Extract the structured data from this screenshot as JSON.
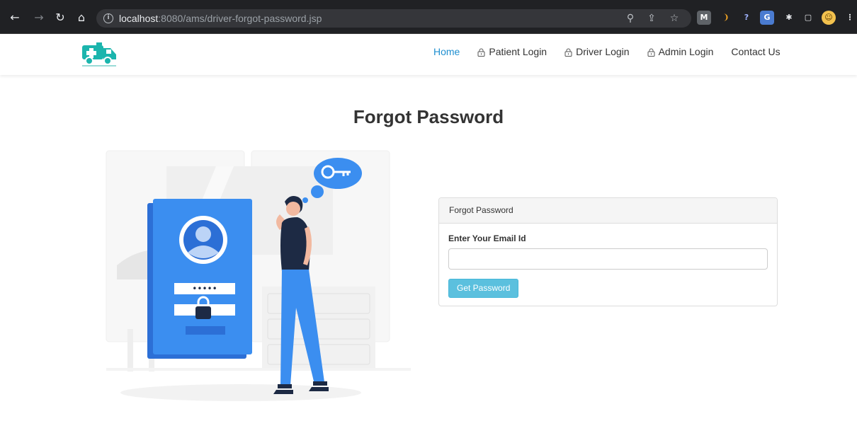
{
  "browser": {
    "url_host": "localhost",
    "url_rest": ":8080/ams/driver-forgot-password.jsp",
    "extensions": [
      {
        "name": "m-extension",
        "glyph": "M",
        "color": "#5f6368"
      },
      {
        "name": "orange-extension",
        "glyph": "❩",
        "color": "#202124"
      },
      {
        "name": "badge-extension",
        "glyph": "0",
        "color": "#202124"
      },
      {
        "name": "translate-extension",
        "glyph": "G",
        "color": "#4a7bd0"
      },
      {
        "name": "puzzle-extension",
        "glyph": "✱",
        "color": "#202124"
      },
      {
        "name": "sidepanel-extension",
        "glyph": "▢",
        "color": "#202124"
      }
    ]
  },
  "nav": {
    "home": "Home",
    "patient_login": "Patient Login",
    "driver_login": "Driver Login",
    "admin_login": "Admin Login",
    "contact_us": "Contact Us"
  },
  "page": {
    "title": "Forgot Password"
  },
  "form": {
    "card_title": "Forgot Password",
    "email_label": "Enter Your Email Id",
    "email_value": "",
    "email_placeholder": "",
    "submit_label": "Get Password",
    "password_mask": "•••••"
  },
  "colors": {
    "accent": "#1f8fd0",
    "button": "#5bc0de",
    "logo": "#1bb5ad",
    "illustration_blue": "#3b8ef0"
  }
}
